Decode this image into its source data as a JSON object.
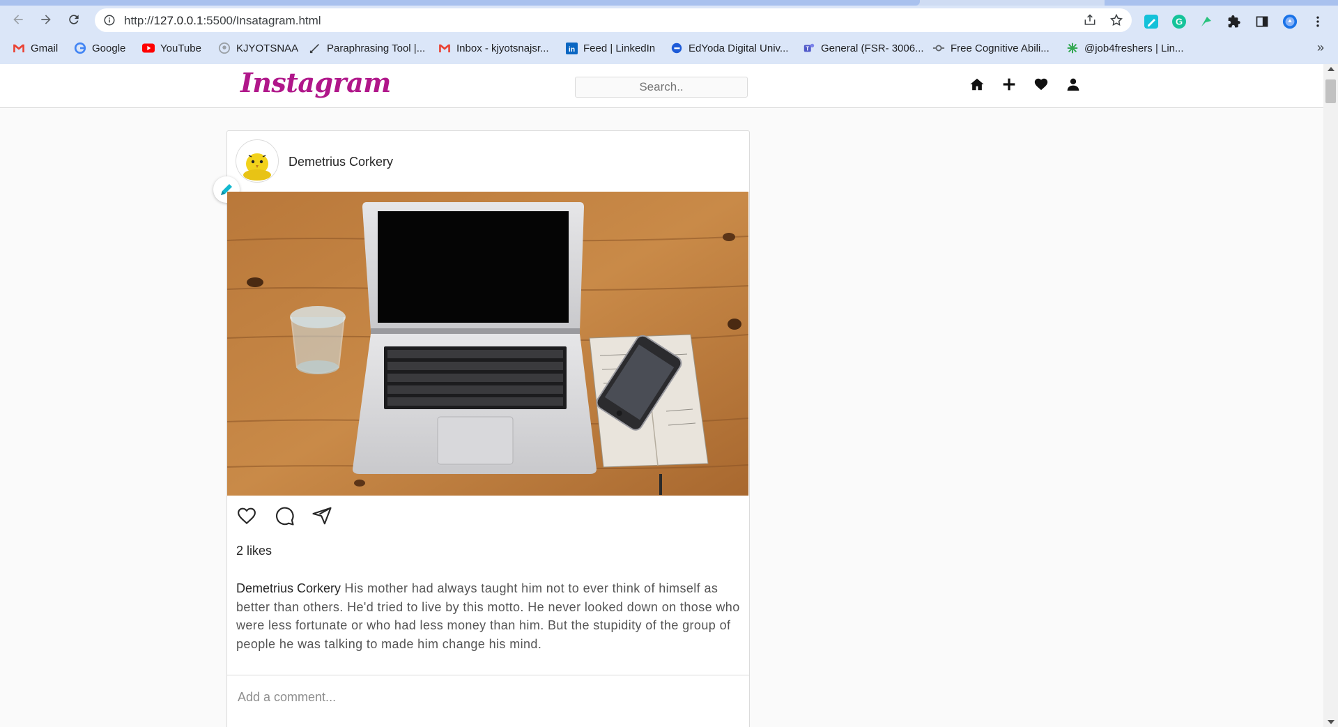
{
  "browser": {
    "url_prefix": "http://",
    "url_host": "127.0.0.1",
    "url_rest": ":5500/Insatagram.html",
    "bookmarks": [
      {
        "label": "Gmail",
        "icon": "gmail-icon"
      },
      {
        "label": "Google",
        "icon": "google-icon"
      },
      {
        "label": "YouTube",
        "icon": "youtube-icon"
      },
      {
        "label": "KJYOTSNAA",
        "icon": "github-icon"
      },
      {
        "label": "Paraphrasing Tool |...",
        "icon": "quill-icon"
      },
      {
        "label": "Inbox - kjyotsnajsr...",
        "icon": "gmail-icon"
      },
      {
        "label": "Feed | LinkedIn",
        "icon": "linkedin-icon"
      },
      {
        "label": "EdYoda Digital Univ...",
        "icon": "edyoda-icon"
      },
      {
        "label": "General (FSR- 3006...",
        "icon": "teams-icon"
      },
      {
        "label": "Free Cognitive Abili...",
        "icon": "cognitive-icon"
      },
      {
        "label": "@job4freshers | Lin...",
        "icon": "job-icon"
      }
    ],
    "more_label": "»"
  },
  "app": {
    "logo": "Instagram",
    "search_placeholder": "Search..",
    "nav_icons": [
      "home-icon",
      "plus-icon",
      "heart-icon",
      "user-icon"
    ],
    "brand_color": "#b0178a"
  },
  "post": {
    "username": "Demetrius Corkery",
    "likes": "2 likes",
    "caption_user": "Demetrius Corkery",
    "caption_text": " His mother had always taught him not to ever think of himself as better than others. He'd tried to live by this motto. He never looked down on those who were less fortunate or who had less money than him. But the stupidity of the group of people he was talking to made him change his mind.",
    "comment_placeholder": "Add a comment...",
    "action_icons": [
      "like-heart-icon",
      "comment-icon",
      "share-icon"
    ]
  }
}
